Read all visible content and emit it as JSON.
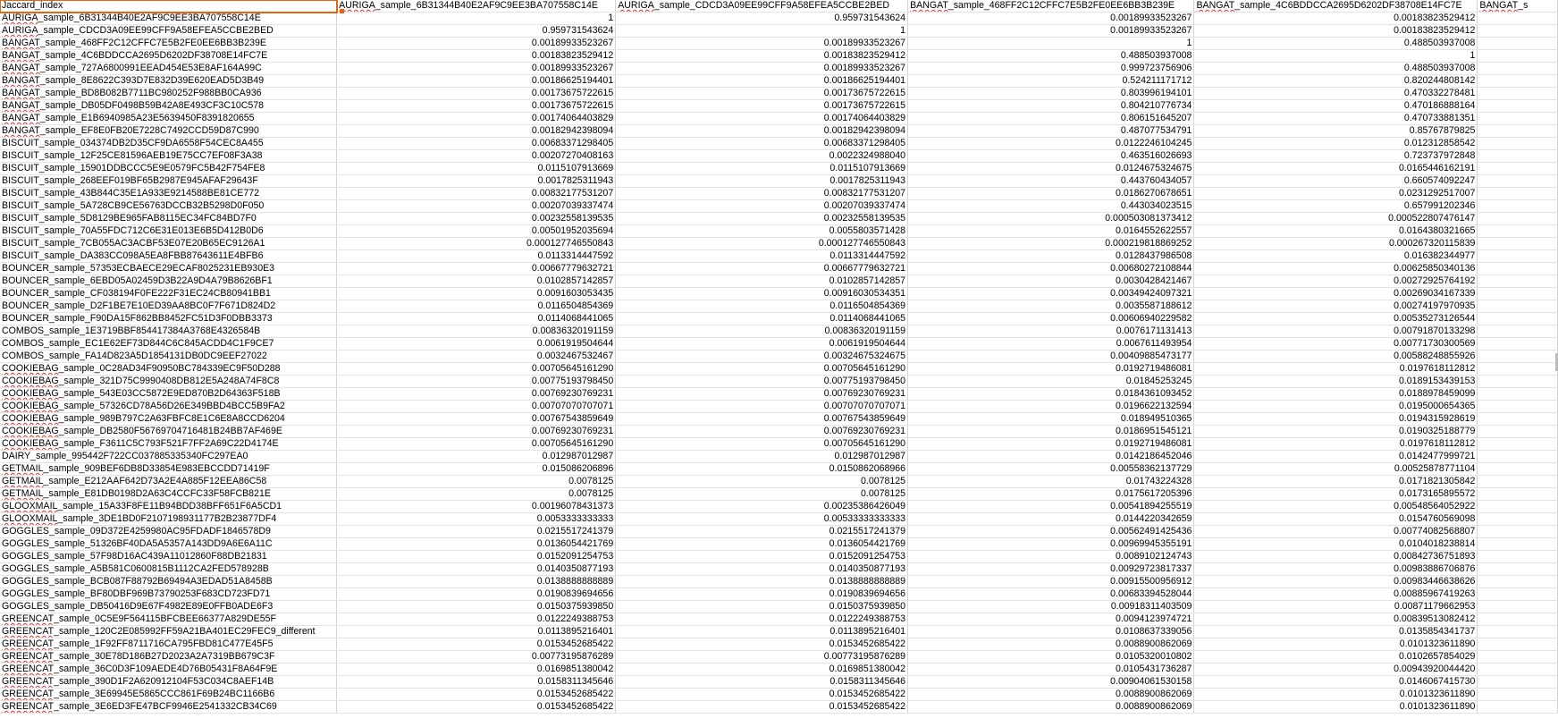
{
  "sheet": {
    "headers": [
      "Jaccard_index",
      "AURIGA_sample_6B31344B40E2AF9C9EE3BA707558C14E",
      "AURIGA_sample_CDCD3A09EE99CFF9A58EFEA5CCBE2BED",
      "BANGAT_sample_468FF2C12CFFC7E5B2FE0EE6BB3B239E",
      "BANGAT_sample_4C6BDDCCA2695D6202DF38708E14FC7E",
      "BANGAT_s"
    ],
    "rows": [
      [
        "AURIGA_sample_6B31344B40E2AF9C9EE3BA707558C14E",
        "1",
        "0.959731543624",
        "0.00189933523267",
        "0.00183823529412",
        ""
      ],
      [
        "AURIGA_sample_CDCD3A09EE99CFF9A58EFEA5CCBE2BED",
        "0.959731543624",
        "1",
        "0.00189933523267",
        "0.00183823529412",
        ""
      ],
      [
        "BANGAT_sample_468FF2C12CFFC7E5B2FE0EE6BB3B239E",
        "0.00189933523267",
        "0.00189933523267",
        "1",
        "0.488503937008",
        ""
      ],
      [
        "BANGAT_sample_4C6BDDCCA2695D6202DF38708E14FC7E",
        "0.00183823529412",
        "0.00183823529412",
        "0.488503937008",
        "1",
        ""
      ],
      [
        "BANGAT_sample_727A6800991EEAD454E53E8AF164A99C",
        "0.00189933523267",
        "0.00189933523267",
        "0.999723756906",
        "0.488503937008",
        ""
      ],
      [
        "BANGAT_sample_8E8622C393D7E832D39E620EAD5D3B49",
        "0.00186625194401",
        "0.00186625194401",
        "0.524211171712",
        "0.820244808142",
        ""
      ],
      [
        "BANGAT_sample_BD8B082B7711BC980252F988BB0CA936",
        "0.00173675722615",
        "0.00173675722615",
        "0.803996194101",
        "0.470332278481",
        ""
      ],
      [
        "BANGAT_sample_DB05DF0498B59B42A8E493CF3C10C578",
        "0.00173675722615",
        "0.00173675722615",
        "0.804210776734",
        "0.470186888164",
        ""
      ],
      [
        "BANGAT_sample_E1B6940985A23E5639450F8391820655",
        "0.00174064403829",
        "0.00174064403829",
        "0.806151645207",
        "0.470733881351",
        ""
      ],
      [
        "BANGAT_sample_EF8E0FB20E7228C7492CCD59D87C990",
        "0.00182942398094",
        "0.00182942398094",
        "0.487077534791",
        "0.85767879825",
        ""
      ],
      [
        "BISCUIT_sample_034374DB2D35CF9DA6558F54CEC8A455",
        "0.00683371298405",
        "0.00683371298405",
        "0.0122246104245",
        "0.012312858542",
        ""
      ],
      [
        "BISCUIT_sample_12F25CE81596AEB19E75CC7EF08F3A38",
        "0.00207270408163",
        "0.0022324988040",
        "0.463516026693",
        "0.723737972848",
        ""
      ],
      [
        "BISCUIT_sample_15901DDBCCC5E9E0579FC5B42F754FE8",
        "0.0115107913669",
        "0.0115107913669",
        "0.0124675324675",
        "0.0165446162191",
        ""
      ],
      [
        "BISCUIT_sample_268EEF019BF65B2987E945AFAF29643F",
        "0.0017825311943",
        "0.0017825311943",
        "0.443760434057",
        "0.660574092247",
        ""
      ],
      [
        "BISCUIT_sample_43B844C35E1A933E9214588BE81CE772",
        "0.00832177531207",
        "0.00832177531207",
        "0.0186270678651",
        "0.0231292517007",
        ""
      ],
      [
        "BISCUIT_sample_5A728CB9CE56763DCCB32B5298D0F050",
        "0.00207039337474",
        "0.00207039337474",
        "0.443034023515",
        "0.657991202346",
        ""
      ],
      [
        "BISCUIT_sample_5D8129BE965FAB8115EC34FC84BD7F0",
        "0.00232558139535",
        "0.00232558139535",
        "0.000503081373412",
        "0.000522807476147",
        ""
      ],
      [
        "BISCUIT_sample_70A55FDC712C6E31E013E6B5D412B0D6",
        "0.00501952035694",
        "0.0055803571428",
        "0.0164552622557",
        "0.0164380321665",
        ""
      ],
      [
        "BISCUIT_sample_7CB055AC3ACBF53E07E20B65EC9126A1",
        "0.000127746550843",
        "0.000127746550843",
        "0.000219818869252",
        "0.000267320115839",
        ""
      ],
      [
        "BISCUIT_sample_DA383CC098A5EA8FBB87643611E4BFB6",
        "0.0113314447592",
        "0.0113314447592",
        "0.0128437986508",
        "0.016382344977",
        ""
      ],
      [
        "BOUNCER_sample_57353ECBAECE29ECAF8025231EB930E3",
        "0.00667779632721",
        "0.00667779632721",
        "0.00680272108844",
        "0.00625850340136",
        ""
      ],
      [
        "BOUNCER_sample_6EBD05A02459D3B22A9D4A79B8626BF1",
        "0.0102857142857",
        "0.0102857142857",
        "0.0030428421467",
        "0.00272925764192",
        ""
      ],
      [
        "BOUNCER_sample_CF038194F0FE222F31EC24CB80941BB1",
        "0.0091603053435",
        "0.00916030534351",
        "0.00349424097321",
        "0.00269034167339",
        ""
      ],
      [
        "BOUNCER_sample_D2F1BE7E10ED39AA8BC0F7F671D824D2",
        "0.0116504854369",
        "0.0116504854369",
        "0.0035587188612",
        "0.00274197970935",
        ""
      ],
      [
        "BOUNCER_sample_F90DA15F862BB8452FC51D3F0DBB3373",
        "0.0114068441065",
        "0.0114068441065",
        "0.00606940229582",
        "0.00535273126544",
        ""
      ],
      [
        "COMBOS_sample_1E3719BBF854417384A3768E4326584B",
        "0.00836320191159",
        "0.00836320191159",
        "0.0076171131413",
        "0.00791870133298",
        ""
      ],
      [
        "COMBOS_sample_EC1E62EF73D844C6C845ACDD4C1F9CE7",
        "0.0061919504644",
        "0.0061919504644",
        "0.0067611493954",
        "0.00771730300569",
        ""
      ],
      [
        "COMBOS_sample_FA14D823A5D1854131DB0DC9EEF27022",
        "0.0032467532467",
        "0.00324675324675",
        "0.00409885473177",
        "0.00588248855926",
        ""
      ],
      [
        "COOKIEBAG_sample_0C28AD34F90950BC784339EC9F50D288",
        "0.00705645161290",
        "0.00705645161290",
        "0.0192719486081",
        "0.0197618112812",
        ""
      ],
      [
        "COOKIEBAG_sample_321D75C9990408DB812E5A248A74F8C8",
        "0.00775193798450",
        "0.00775193798450",
        "0.01845253245",
        "0.0189153439153",
        ""
      ],
      [
        "COOKIEBAG_sample_543E03CC5872E9ED870B2D64363F518B",
        "0.00769230769231",
        "0.00769230769231",
        "0.0184361093452",
        "0.0188978459099",
        ""
      ],
      [
        "COOKIEBAG_sample_57326CD78A56D26E349BBD4BCC5B9FA2",
        "0.00707070707071",
        "0.00707070707071",
        "0.0196622132594",
        "0.0195000654365",
        ""
      ],
      [
        "COOKIEBAG_sample_989B797C2A63FBFC8E1C6E8A8CCD6204",
        "0.00767543859649",
        "0.00767543859649",
        "0.018949510365",
        "0.0194315928619",
        ""
      ],
      [
        "COOKIEBAG_sample_DB2580F56769704716481B24BB7AF469E",
        "0.00769230769231",
        "0.00769230769231",
        "0.0186951545121",
        "0.0190325188779",
        ""
      ],
      [
        "COOKIEBAG_sample_F3611C5C793F521F7FF2A69C22D4174E",
        "0.00705645161290",
        "0.00705645161290",
        "0.0192719486081",
        "0.0197618112812",
        ""
      ],
      [
        "DAIRY_sample_995442F722CC037885335340FC297EA0",
        "0.012987012987",
        "0.012987012987",
        "0.0142186452046",
        "0.0142477999721",
        ""
      ],
      [
        "GETMAIL_sample_909BEF6DB8D33854E983EBCCDD71419F",
        "0.015086206896",
        "0.0150862068966",
        "0.00558362137729",
        "0.00525878771104",
        ""
      ],
      [
        "GETMAIL_sample_E212AAF642D73A2E4A885F12EEA86C58",
        "0.0078125",
        "0.0078125",
        "0.01743224328",
        "0.0171821305842",
        ""
      ],
      [
        "GETMAIL_sample_E81DB0198D2A63C4CCFC33F58FCB821E",
        "0.0078125",
        "0.0078125",
        "0.0175617205396",
        "0.0173165895572",
        ""
      ],
      [
        "GLOOXMAIL_sample_15A33F8FE11B94BDD38BFF651F6A5CD1",
        "0.00196078431373",
        "0.00235386426049",
        "0.00541894255519",
        "0.00548564052922",
        ""
      ],
      [
        "GLOOXMAIL_sample_3DE1BD0F2107198931177B2B23877DF4",
        "0.0053333333333",
        "0.00533333333333",
        "0.0144220342659",
        "0.0154760569098",
        ""
      ],
      [
        "GOGGLES_sample_09D372E4259980AC95FDADF1846578D9",
        "0.0215517241379",
        "0.0215517241379",
        "0.00562491425436",
        "0.00774082568807",
        ""
      ],
      [
        "GOGGLES_sample_51326BF40DA5A5357A143DD9A6E6A11C",
        "0.0136054421769",
        "0.0136054421769",
        "0.00969945355191",
        "0.0104018238814",
        ""
      ],
      [
        "GOGGLES_sample_57F98D16AC439A11012860F88DB21831",
        "0.0152091254753",
        "0.0152091254753",
        "0.0089102124743",
        "0.00842736751893",
        ""
      ],
      [
        "GOGGLES_sample_A5B581C0600815B1112CA2FED578928B",
        "0.0140350877193",
        "0.0140350877193",
        "0.00929723817337",
        "0.00983886706876",
        ""
      ],
      [
        "GOGGLES_sample_BCB087F88792B69494A3EDAD51A8458B",
        "0.0138888888889",
        "0.0138888888889",
        "0.00915500956912",
        "0.00983446638626",
        ""
      ],
      [
        "GOGGLES_sample_BF80DBF969B73790253F683CD723FD71",
        "0.0190839694656",
        "0.0190839694656",
        "0.00683394528044",
        "0.00885967419263",
        ""
      ],
      [
        "GOGGLES_sample_DB50416D9E67F4982E89E0FFB0ADE6F3",
        "0.0150375939850",
        "0.0150375939850",
        "0.00918311403509",
        "0.00871179662953",
        ""
      ],
      [
        "GREENCAT_sample_0C5E9F564115BFCBEE66377A829DE55F",
        "0.0122249388753",
        "0.0122249388753",
        "0.0094123974721",
        "0.00839513082412",
        ""
      ],
      [
        "GREENCAT_sample_120C2E085992FF59A21BA401EC29FEC9_different",
        "0.0113895216401",
        "0.0113895216401",
        "0.0108637339056",
        "0.0135854341737",
        ""
      ],
      [
        "GREENCAT_sample_1F92FF8711716CA795FBD81C477E45F5",
        "0.0153452685422",
        "0.0153452685422",
        "0.0088900862069",
        "0.0101323611890",
        ""
      ],
      [
        "GREENCAT_sample_30E78D186B27D2023A2A7319BB679C3F",
        "0.00773195876289",
        "0.00773195876289",
        "0.0105320010802",
        "0.0102657854029",
        ""
      ],
      [
        "GREENCAT_sample_36C0D3F109AEDE4D76B05431F8A64F9E",
        "0.0169851380042",
        "0.0169851380042",
        "0.0105431736287",
        "0.00943920044420",
        ""
      ],
      [
        "GREENCAT_sample_390D1F2A620912104F53C034C8AEF14B",
        "0.0158311345646",
        "0.0158311345646",
        "0.00904061530158",
        "0.0146067415730",
        ""
      ],
      [
        "GREENCAT_sample_3E69945E5865CCC861F69B24BC1166B6",
        "0.0153452685422",
        "0.0153452685422",
        "0.0088900862069",
        "0.0101323611890",
        ""
      ],
      [
        "GREENCAT_sample_3E6ED3FE47BCF9946E2541332CB34C69",
        "0.0153452685422",
        "0.0153452685422",
        "0.0088900862069",
        "0.0101323611890",
        ""
      ]
    ],
    "squiggle_prefixes": [
      "AURIGA",
      "BANGAT",
      "COOKIEBAG",
      "GETMAIL",
      "GLOOXMAIL",
      "GREENCAT"
    ]
  }
}
